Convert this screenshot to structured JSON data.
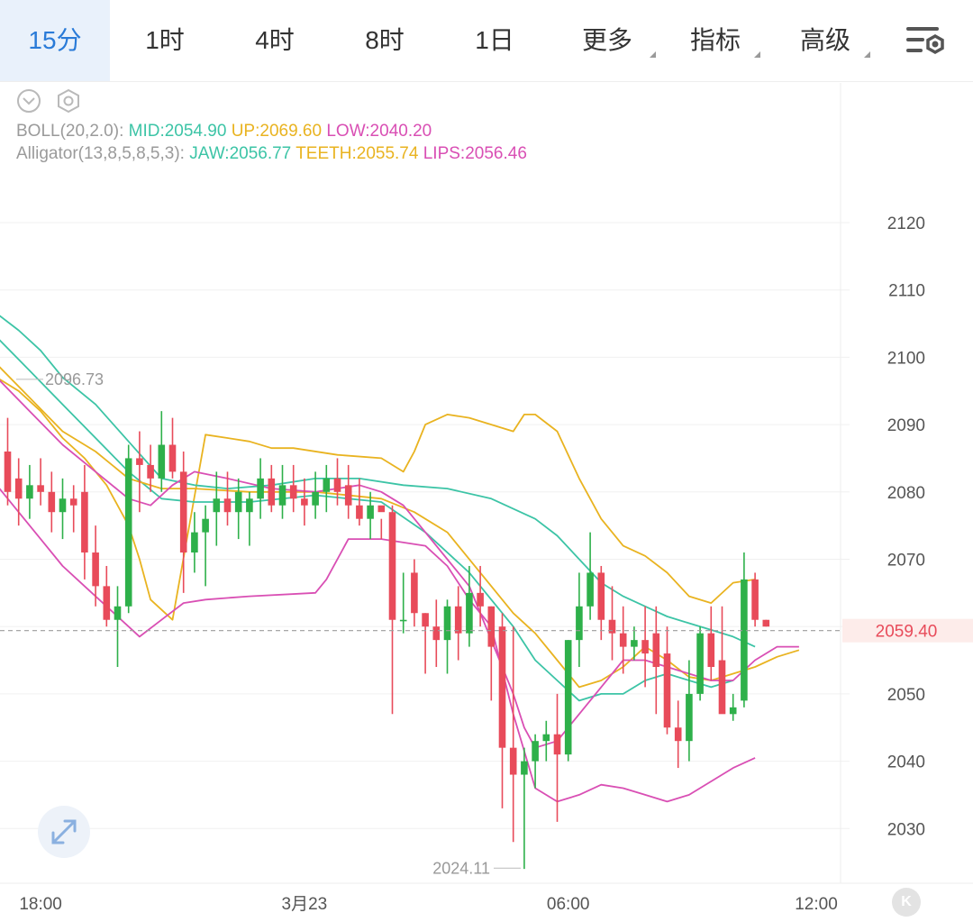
{
  "tabs": [
    {
      "label": "15分",
      "active": true
    },
    {
      "label": "1时",
      "active": false
    },
    {
      "label": "4时",
      "active": false
    },
    {
      "label": "8时",
      "active": false
    },
    {
      "label": "1日",
      "active": false
    },
    {
      "label": "更多",
      "active": false,
      "dropdown": true
    },
    {
      "label": "指标",
      "active": false,
      "dropdown": true
    },
    {
      "label": "高级",
      "active": false,
      "dropdown": true
    }
  ],
  "icons": {
    "settings": "chart-settings-icon",
    "collapse": "chevron-down-circle-icon",
    "eye": "eye-icon",
    "expand": "expand-arrows-icon",
    "k_button": "K"
  },
  "indicators": {
    "boll": {
      "name": "BOLL(20,2.0):",
      "mid": "MID:2054.90",
      "up": "UP:2069.60",
      "low": "LOW:2040.20"
    },
    "alligator": {
      "name": "Alligator(13,8,5,8,5,3):",
      "jaw": "JAW:2056.77",
      "teeth": "TEETH:2055.74",
      "lips": "LIPS:2056.46"
    }
  },
  "colors": {
    "up": "#2eb04a",
    "down": "#e84b5a",
    "mid": "#3cc4a6",
    "upper": "#e9b320",
    "lower": "#d94fb4",
    "accent": "#2a7bd8",
    "price_label": "#e84b5a"
  },
  "chart_data": {
    "type": "candlestick",
    "symbol_interval": "15分",
    "y_axis": {
      "ticks": [
        2030,
        2040,
        2050,
        2060,
        2070,
        2080,
        2090,
        2100,
        2110,
        2120
      ],
      "labels": [
        "2030",
        "2040",
        "2050",
        "2060",
        "2070",
        "2080",
        "2090",
        "2100",
        "2110",
        "2120"
      ]
    },
    "x_axis": {
      "labels": [
        "18:00",
        "3月23",
        "06:00",
        "12:00"
      ],
      "label_bar_index": [
        3,
        27,
        51,
        75
      ]
    },
    "current_price": "2059.40",
    "annotations": {
      "high": "2096.73",
      "low": "2024.11"
    },
    "candles": [
      [
        2086,
        2091,
        2078,
        2080
      ],
      [
        2082,
        2085,
        2075,
        2079
      ],
      [
        2079,
        2084,
        2076,
        2081
      ],
      [
        2081,
        2085,
        2078,
        2080
      ],
      [
        2080,
        2083,
        2074,
        2077
      ],
      [
        2077,
        2082,
        2073,
        2079
      ],
      [
        2079,
        2081,
        2074,
        2078
      ],
      [
        2080,
        2084,
        2067,
        2071
      ],
      [
        2071,
        2075,
        2063,
        2066
      ],
      [
        2066,
        2069,
        2060,
        2061
      ],
      [
        2061,
        2066,
        2054,
        2063
      ],
      [
        2063,
        2087,
        2062,
        2085
      ],
      [
        2085,
        2089,
        2077,
        2084
      ],
      [
        2084,
        2087,
        2080,
        2082
      ],
      [
        2082,
        2092,
        2080,
        2087
      ],
      [
        2087,
        2091,
        2082,
        2083
      ],
      [
        2083,
        2086,
        2065,
        2071
      ],
      [
        2071,
        2077,
        2068,
        2074
      ],
      [
        2074,
        2078,
        2066,
        2076
      ],
      [
        2077,
        2083,
        2072,
        2079
      ],
      [
        2079,
        2083,
        2075,
        2077
      ],
      [
        2077,
        2082,
        2073,
        2080
      ],
      [
        2077,
        2080,
        2072,
        2079
      ],
      [
        2079,
        2085,
        2076,
        2082
      ],
      [
        2082,
        2084,
        2077,
        2078
      ],
      [
        2078,
        2084,
        2076,
        2081
      ],
      [
        2081,
        2084,
        2077,
        2079
      ],
      [
        2079,
        2082,
        2075,
        2078
      ],
      [
        2078,
        2083,
        2076,
        2080
      ],
      [
        2080,
        2084,
        2077,
        2082
      ],
      [
        2082,
        2085,
        2078,
        2080
      ],
      [
        2081,
        2084,
        2076,
        2078
      ],
      [
        2078,
        2082,
        2075,
        2076
      ],
      [
        2076,
        2080,
        2073,
        2078
      ],
      [
        2078,
        2076,
        2073,
        2077
      ],
      [
        2077,
        2078,
        2047,
        2061
      ],
      [
        2061,
        2068,
        2059,
        2061
      ],
      [
        2068,
        2070,
        2060,
        2062
      ],
      [
        2062,
        2062,
        2053,
        2060
      ],
      [
        2060,
        2064,
        2054,
        2058
      ],
      [
        2058,
        2064,
        2053,
        2063
      ],
      [
        2063,
        2066,
        2055,
        2059
      ],
      [
        2059,
        2069,
        2057,
        2065
      ],
      [
        2065,
        2069,
        2060,
        2063
      ],
      [
        2063,
        2063,
        2049,
        2057
      ],
      [
        2060,
        2062,
        2033,
        2042
      ],
      [
        2042,
        2060,
        2028,
        2038
      ],
      [
        2038,
        2042,
        2024,
        2040
      ],
      [
        2040,
        2044,
        2036,
        2043
      ],
      [
        2043,
        2046,
        2040,
        2044
      ],
      [
        2044,
        2050,
        2031,
        2041
      ],
      [
        2041,
        2058,
        2040,
        2058
      ],
      [
        2058,
        2068,
        2054,
        2063
      ],
      [
        2063,
        2074,
        2061,
        2068
      ],
      [
        2068,
        2069,
        2058,
        2061
      ],
      [
        2061,
        2066,
        2055,
        2059
      ],
      [
        2059,
        2063,
        2053,
        2057
      ],
      [
        2057,
        2060,
        2055,
        2058
      ],
      [
        2058,
        2063,
        2051,
        2056
      ],
      [
        2059,
        2063,
        2047,
        2054
      ],
      [
        2056,
        2060,
        2044,
        2045
      ],
      [
        2045,
        2049,
        2039,
        2043
      ],
      [
        2043,
        2055,
        2040,
        2050
      ],
      [
        2050,
        2060,
        2049,
        2059
      ],
      [
        2059,
        2063,
        2052,
        2054
      ],
      [
        2055,
        2063,
        2048,
        2047
      ],
      [
        2047,
        2050,
        2046,
        2048
      ],
      [
        2049,
        2071,
        2048,
        2067
      ],
      [
        2067,
        2068,
        2060,
        2061
      ],
      [
        2061,
        2061,
        2060,
        2060
      ]
    ],
    "series": [
      {
        "name": "BOLL UP",
        "color_key": "upper"
      },
      {
        "name": "BOLL MID",
        "color_key": "mid"
      },
      {
        "name": "BOLL LOW",
        "color_key": "lower"
      },
      {
        "name": "Alligator JAW",
        "color_key": "mid"
      },
      {
        "name": "Alligator TEETH",
        "color_key": "upper"
      },
      {
        "name": "Alligator LIPS",
        "color_key": "lower"
      }
    ],
    "lines": {
      "boll_up": [
        [
          -1,
          2097
        ],
        [
          1,
          2095
        ],
        [
          3,
          2092
        ],
        [
          5,
          2088
        ],
        [
          7,
          2085
        ],
        [
          9,
          2081
        ],
        [
          11,
          2075
        ],
        [
          12,
          2070
        ],
        [
          13,
          2064
        ],
        [
          15,
          2061
        ],
        [
          18,
          2088.5
        ],
        [
          20,
          2088
        ],
        [
          22,
          2087.5
        ],
        [
          24,
          2086.5
        ],
        [
          26,
          2086.5
        ],
        [
          30,
          2085.5
        ],
        [
          34,
          2085
        ],
        [
          36,
          2083
        ],
        [
          37,
          2086
        ],
        [
          38,
          2090
        ],
        [
          40,
          2091.5
        ],
        [
          42,
          2091
        ],
        [
          44,
          2090
        ],
        [
          46,
          2089
        ],
        [
          47,
          2091.5
        ],
        [
          48,
          2091.5
        ],
        [
          50,
          2089
        ],
        [
          52,
          2082
        ],
        [
          54,
          2076
        ],
        [
          56,
          2072
        ],
        [
          58,
          2070.5
        ],
        [
          60,
          2068
        ],
        [
          62,
          2064.5
        ],
        [
          64,
          2063.5
        ],
        [
          66,
          2066.5
        ],
        [
          68,
          2067
        ]
      ],
      "boll_mid": [
        [
          -1,
          2106.5
        ],
        [
          1,
          2104
        ],
        [
          3,
          2101
        ],
        [
          5,
          2097
        ],
        [
          8,
          2093
        ],
        [
          11,
          2087.5
        ],
        [
          14,
          2082
        ],
        [
          17,
          2081
        ],
        [
          20,
          2080.5
        ],
        [
          24,
          2081
        ],
        [
          28,
          2082
        ],
        [
          32,
          2082
        ],
        [
          36,
          2081
        ],
        [
          40,
          2080.5
        ],
        [
          44,
          2079
        ],
        [
          48,
          2076
        ],
        [
          50,
          2073.5
        ],
        [
          52,
          2070
        ],
        [
          54,
          2066.5
        ],
        [
          56,
          2064.5
        ],
        [
          58,
          2063
        ],
        [
          60,
          2061.5
        ],
        [
          62,
          2060.5
        ],
        [
          64,
          2059.5
        ],
        [
          66,
          2058.5
        ],
        [
          68,
          2057
        ]
      ],
      "boll_low": [
        [
          -1,
          2081
        ],
        [
          1,
          2077
        ],
        [
          3,
          2073
        ],
        [
          5,
          2069
        ],
        [
          7,
          2066
        ],
        [
          9,
          2063
        ],
        [
          11,
          2060
        ],
        [
          12,
          2058.5
        ],
        [
          14,
          2061
        ],
        [
          16,
          2063.5
        ],
        [
          18,
          2064
        ],
        [
          22,
          2064.5
        ],
        [
          28,
          2065
        ],
        [
          29,
          2067
        ],
        [
          31,
          2073
        ],
        [
          34,
          2073
        ],
        [
          38,
          2072
        ],
        [
          40,
          2069
        ],
        [
          42,
          2064
        ],
        [
          44,
          2060
        ],
        [
          46,
          2047
        ],
        [
          48,
          2036
        ],
        [
          50,
          2034
        ],
        [
          52,
          2035
        ],
        [
          54,
          2036.5
        ],
        [
          56,
          2036
        ],
        [
          58,
          2035
        ],
        [
          60,
          2034
        ],
        [
          62,
          2035
        ],
        [
          64,
          2037
        ],
        [
          66,
          2039
        ],
        [
          68,
          2040.5
        ]
      ],
      "alligator_jaw": [
        [
          -1,
          2103
        ],
        [
          2,
          2098
        ],
        [
          5,
          2093
        ],
        [
          8,
          2088
        ],
        [
          11,
          2083
        ],
        [
          14,
          2079
        ],
        [
          17,
          2078.5
        ],
        [
          22,
          2078.5
        ],
        [
          28,
          2079.5
        ],
        [
          34,
          2078.5
        ],
        [
          38,
          2074
        ],
        [
          42,
          2068
        ],
        [
          46,
          2060
        ],
        [
          48,
          2055
        ],
        [
          50,
          2052
        ],
        [
          52,
          2049
        ],
        [
          54,
          2050
        ],
        [
          56,
          2050
        ],
        [
          58,
          2052
        ],
        [
          60,
          2053
        ],
        [
          62,
          2052
        ],
        [
          64,
          2051
        ],
        [
          66,
          2052
        ]
      ],
      "alligator_teeth": [
        [
          -1,
          2099
        ],
        [
          2,
          2094
        ],
        [
          5,
          2089
        ],
        [
          8,
          2086
        ],
        [
          11,
          2082
        ],
        [
          14,
          2080.5
        ],
        [
          17,
          2080.5
        ],
        [
          22,
          2080
        ],
        [
          28,
          2080
        ],
        [
          34,
          2079
        ],
        [
          37,
          2077
        ],
        [
          40,
          2074
        ],
        [
          43,
          2068
        ],
        [
          46,
          2062
        ],
        [
          48,
          2059
        ],
        [
          50,
          2055
        ],
        [
          52,
          2051
        ],
        [
          54,
          2052
        ],
        [
          56,
          2054
        ],
        [
          58,
          2057
        ],
        [
          60,
          2055
        ],
        [
          62,
          2052.5
        ],
        [
          64,
          2052
        ],
        [
          66,
          2053
        ],
        [
          68,
          2054
        ],
        [
          70,
          2055.5
        ],
        [
          72,
          2056.5
        ]
      ],
      "alligator_lips": [
        [
          -1,
          2097
        ],
        [
          2,
          2092
        ],
        [
          5,
          2087
        ],
        [
          8,
          2083
        ],
        [
          11,
          2079
        ],
        [
          13,
          2078
        ],
        [
          15,
          2081
        ],
        [
          17,
          2083
        ],
        [
          20,
          2082
        ],
        [
          24,
          2080.5
        ],
        [
          28,
          2080
        ],
        [
          32,
          2081
        ],
        [
          34,
          2080
        ],
        [
          36,
          2078
        ],
        [
          38,
          2074
        ],
        [
          40,
          2070
        ],
        [
          42,
          2066
        ],
        [
          44,
          2058
        ],
        [
          46,
          2050
        ],
        [
          47,
          2045
        ],
        [
          48,
          2042
        ],
        [
          50,
          2043
        ],
        [
          52,
          2047
        ],
        [
          54,
          2051
        ],
        [
          56,
          2055
        ],
        [
          58,
          2055
        ],
        [
          60,
          2054
        ],
        [
          62,
          2053
        ],
        [
          64,
          2052
        ],
        [
          66,
          2052
        ],
        [
          68,
          2055
        ],
        [
          70,
          2057
        ],
        [
          72,
          2057
        ]
      ]
    }
  }
}
